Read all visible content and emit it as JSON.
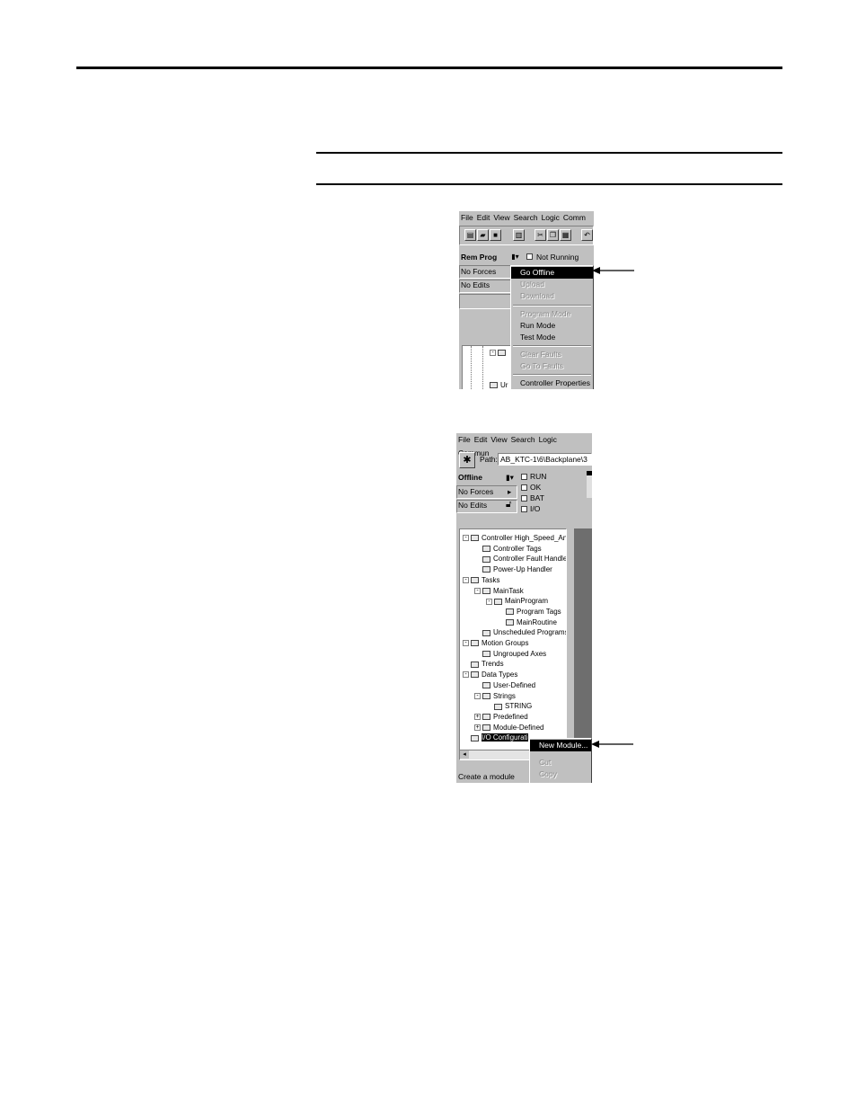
{
  "shot1": {
    "menus": [
      "File",
      "Edit",
      "View",
      "Search",
      "Logic",
      "Comm"
    ],
    "toolbar_icons": [
      "new-icon",
      "open-icon",
      "save-icon",
      "print-icon",
      "cut-icon",
      "copy-icon",
      "paste-icon",
      "undo-icon"
    ],
    "mode": "Rem Prog",
    "run_status": "Not Running",
    "forces": "No Forces",
    "edits": "No Edits",
    "tree_fragment": "Ur",
    "menu_items": [
      {
        "label": "Go Offline",
        "state": "selected"
      },
      {
        "label": "Upload",
        "state": "disabled"
      },
      {
        "label": "Download",
        "state": "disabled"
      },
      {
        "label": "Program Mode",
        "state": "disabled"
      },
      {
        "label": "Run Mode",
        "state": "enabled"
      },
      {
        "label": "Test Mode",
        "state": "enabled"
      },
      {
        "label": "Clear Faults",
        "state": "disabled"
      },
      {
        "label": "Go To Faults",
        "state": "disabled"
      },
      {
        "label": "Controller Properties",
        "state": "enabled"
      }
    ]
  },
  "shot2": {
    "menus": [
      "File",
      "Edit",
      "View",
      "Search",
      "Logic",
      "Commun"
    ],
    "path_label": "Path:",
    "path_value": "AB_KTC-1\\6\\Backplane\\3",
    "mode": "Offline",
    "forces": "No Forces",
    "edits": "No Edits",
    "status_leds": [
      "RUN",
      "OK",
      "BAT",
      "I/O"
    ],
    "tree": [
      {
        "label": "Controller High_Speed_Anal",
        "level": 0,
        "expander": "-"
      },
      {
        "label": "Controller Tags",
        "level": 1,
        "expander": ""
      },
      {
        "label": "Controller Fault Handler",
        "level": 1,
        "expander": ""
      },
      {
        "label": "Power-Up Handler",
        "level": 1,
        "expander": ""
      },
      {
        "label": "Tasks",
        "level": 0,
        "expander": "-"
      },
      {
        "label": "MainTask",
        "level": 1,
        "expander": "-"
      },
      {
        "label": "MainProgram",
        "level": 2,
        "expander": "-"
      },
      {
        "label": "Program Tags",
        "level": 3,
        "expander": ""
      },
      {
        "label": "MainRoutine",
        "level": 3,
        "expander": ""
      },
      {
        "label": "Unscheduled Programs",
        "level": 1,
        "expander": ""
      },
      {
        "label": "Motion Groups",
        "level": 0,
        "expander": "-"
      },
      {
        "label": "Ungrouped Axes",
        "level": 1,
        "expander": ""
      },
      {
        "label": "Trends",
        "level": 0,
        "expander": ""
      },
      {
        "label": "Data Types",
        "level": 0,
        "expander": "-"
      },
      {
        "label": "User-Defined",
        "level": 1,
        "expander": ""
      },
      {
        "label": "Strings",
        "level": 1,
        "expander": "-"
      },
      {
        "label": "STRING",
        "level": 2,
        "expander": ""
      },
      {
        "label": "Predefined",
        "level": 1,
        "expander": "+"
      },
      {
        "label": "Module-Defined",
        "level": 1,
        "expander": "+"
      },
      {
        "label": "I/O Configurati",
        "level": 0,
        "expander": ""
      }
    ],
    "context_menu": [
      {
        "label": "New Module...",
        "state": "selected"
      },
      {
        "label": "Cut",
        "state": "disabled"
      },
      {
        "label": "Copy",
        "state": "disabled"
      }
    ],
    "status_bar": "Create a module"
  }
}
